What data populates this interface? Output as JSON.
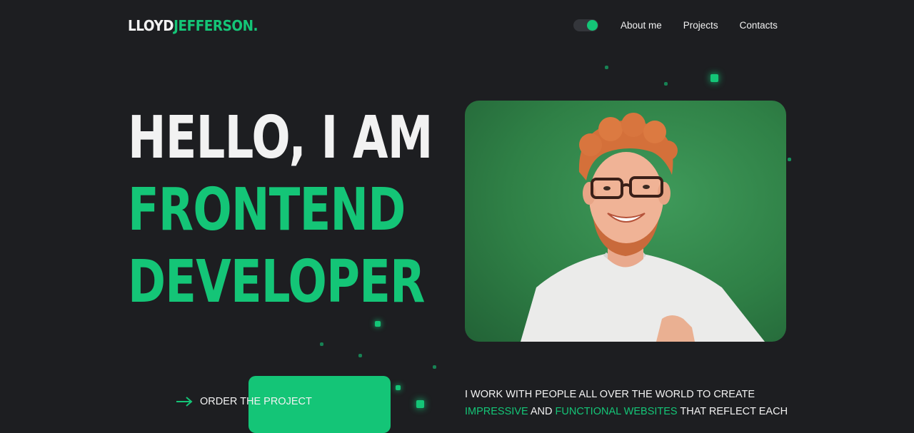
{
  "header": {
    "logo_first": "LLOYD",
    "logo_last": "JEFFERSON.",
    "theme_toggle": "theme-toggle",
    "nav": [
      "About me",
      "Projects",
      "Contacts"
    ]
  },
  "hero": {
    "line1": "HELLO, I AM",
    "line2": "FRONTEND",
    "line3": "DEVELOPER"
  },
  "cta": {
    "label": "ORDER THE PROJECT"
  },
  "about": {
    "line1": "I WORK WITH PEOPLE ALL OVER THE WORLD TO CREATE",
    "accent1": "IMPRESSIVE",
    "and": "AND",
    "accent2": "FUNCTIONAL WEBSITES",
    "tail": "THAT REFLECT EACH"
  },
  "colors": {
    "background": "#1d1e21",
    "accent": "#14c577",
    "text": "#f2f2f2"
  }
}
